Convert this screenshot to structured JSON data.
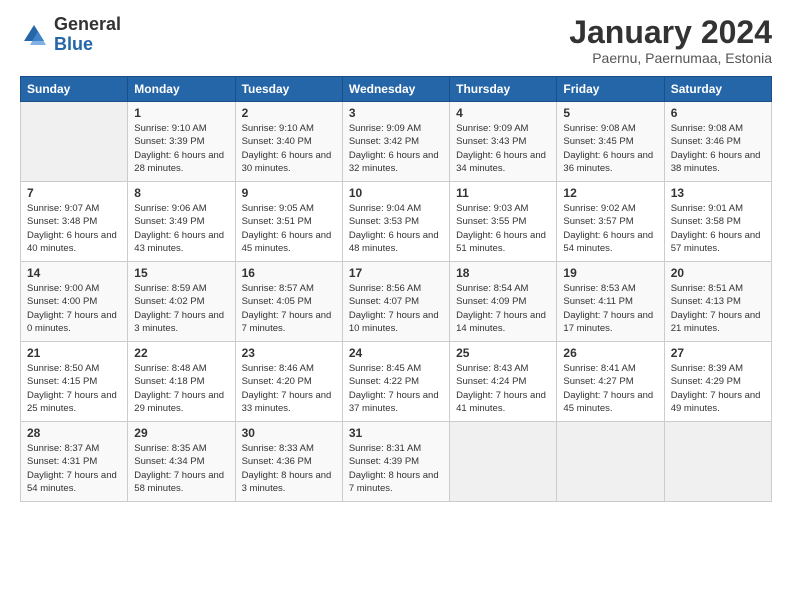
{
  "logo": {
    "general": "General",
    "blue": "Blue"
  },
  "header": {
    "month": "January 2024",
    "location": "Paernu, Paernumaa, Estonia"
  },
  "days_of_week": [
    "Sunday",
    "Monday",
    "Tuesday",
    "Wednesday",
    "Thursday",
    "Friday",
    "Saturday"
  ],
  "weeks": [
    [
      {
        "num": "",
        "info": ""
      },
      {
        "num": "1",
        "info": "Sunrise: 9:10 AM\nSunset: 3:39 PM\nDaylight: 6 hours\nand 28 minutes."
      },
      {
        "num": "2",
        "info": "Sunrise: 9:10 AM\nSunset: 3:40 PM\nDaylight: 6 hours\nand 30 minutes."
      },
      {
        "num": "3",
        "info": "Sunrise: 9:09 AM\nSunset: 3:42 PM\nDaylight: 6 hours\nand 32 minutes."
      },
      {
        "num": "4",
        "info": "Sunrise: 9:09 AM\nSunset: 3:43 PM\nDaylight: 6 hours\nand 34 minutes."
      },
      {
        "num": "5",
        "info": "Sunrise: 9:08 AM\nSunset: 3:45 PM\nDaylight: 6 hours\nand 36 minutes."
      },
      {
        "num": "6",
        "info": "Sunrise: 9:08 AM\nSunset: 3:46 PM\nDaylight: 6 hours\nand 38 minutes."
      }
    ],
    [
      {
        "num": "7",
        "info": "Sunrise: 9:07 AM\nSunset: 3:48 PM\nDaylight: 6 hours\nand 40 minutes."
      },
      {
        "num": "8",
        "info": "Sunrise: 9:06 AM\nSunset: 3:49 PM\nDaylight: 6 hours\nand 43 minutes."
      },
      {
        "num": "9",
        "info": "Sunrise: 9:05 AM\nSunset: 3:51 PM\nDaylight: 6 hours\nand 45 minutes."
      },
      {
        "num": "10",
        "info": "Sunrise: 9:04 AM\nSunset: 3:53 PM\nDaylight: 6 hours\nand 48 minutes."
      },
      {
        "num": "11",
        "info": "Sunrise: 9:03 AM\nSunset: 3:55 PM\nDaylight: 6 hours\nand 51 minutes."
      },
      {
        "num": "12",
        "info": "Sunrise: 9:02 AM\nSunset: 3:57 PM\nDaylight: 6 hours\nand 54 minutes."
      },
      {
        "num": "13",
        "info": "Sunrise: 9:01 AM\nSunset: 3:58 PM\nDaylight: 6 hours\nand 57 minutes."
      }
    ],
    [
      {
        "num": "14",
        "info": "Sunrise: 9:00 AM\nSunset: 4:00 PM\nDaylight: 7 hours\nand 0 minutes."
      },
      {
        "num": "15",
        "info": "Sunrise: 8:59 AM\nSunset: 4:02 PM\nDaylight: 7 hours\nand 3 minutes."
      },
      {
        "num": "16",
        "info": "Sunrise: 8:57 AM\nSunset: 4:05 PM\nDaylight: 7 hours\nand 7 minutes."
      },
      {
        "num": "17",
        "info": "Sunrise: 8:56 AM\nSunset: 4:07 PM\nDaylight: 7 hours\nand 10 minutes."
      },
      {
        "num": "18",
        "info": "Sunrise: 8:54 AM\nSunset: 4:09 PM\nDaylight: 7 hours\nand 14 minutes."
      },
      {
        "num": "19",
        "info": "Sunrise: 8:53 AM\nSunset: 4:11 PM\nDaylight: 7 hours\nand 17 minutes."
      },
      {
        "num": "20",
        "info": "Sunrise: 8:51 AM\nSunset: 4:13 PM\nDaylight: 7 hours\nand 21 minutes."
      }
    ],
    [
      {
        "num": "21",
        "info": "Sunrise: 8:50 AM\nSunset: 4:15 PM\nDaylight: 7 hours\nand 25 minutes."
      },
      {
        "num": "22",
        "info": "Sunrise: 8:48 AM\nSunset: 4:18 PM\nDaylight: 7 hours\nand 29 minutes."
      },
      {
        "num": "23",
        "info": "Sunrise: 8:46 AM\nSunset: 4:20 PM\nDaylight: 7 hours\nand 33 minutes."
      },
      {
        "num": "24",
        "info": "Sunrise: 8:45 AM\nSunset: 4:22 PM\nDaylight: 7 hours\nand 37 minutes."
      },
      {
        "num": "25",
        "info": "Sunrise: 8:43 AM\nSunset: 4:24 PM\nDaylight: 7 hours\nand 41 minutes."
      },
      {
        "num": "26",
        "info": "Sunrise: 8:41 AM\nSunset: 4:27 PM\nDaylight: 7 hours\nand 45 minutes."
      },
      {
        "num": "27",
        "info": "Sunrise: 8:39 AM\nSunset: 4:29 PM\nDaylight: 7 hours\nand 49 minutes."
      }
    ],
    [
      {
        "num": "28",
        "info": "Sunrise: 8:37 AM\nSunset: 4:31 PM\nDaylight: 7 hours\nand 54 minutes."
      },
      {
        "num": "29",
        "info": "Sunrise: 8:35 AM\nSunset: 4:34 PM\nDaylight: 7 hours\nand 58 minutes."
      },
      {
        "num": "30",
        "info": "Sunrise: 8:33 AM\nSunset: 4:36 PM\nDaylight: 8 hours\nand 3 minutes."
      },
      {
        "num": "31",
        "info": "Sunrise: 8:31 AM\nSunset: 4:39 PM\nDaylight: 8 hours\nand 7 minutes."
      },
      {
        "num": "",
        "info": ""
      },
      {
        "num": "",
        "info": ""
      },
      {
        "num": "",
        "info": ""
      }
    ]
  ]
}
